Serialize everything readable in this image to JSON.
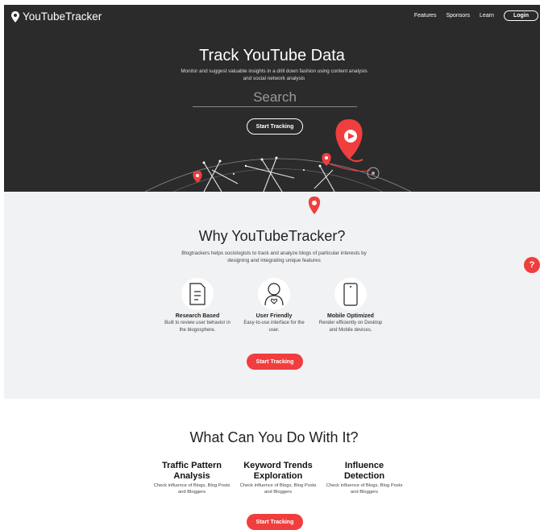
{
  "header": {
    "brand": "YouTubeTracker",
    "nav": [
      "Features",
      "Sponsors",
      "Learn"
    ],
    "login_label": "Login"
  },
  "hero": {
    "title": "Track YouTube Data",
    "subtitle": "Monitor and suggest valuable insights in a drill down fashion using content analysis and social network analysis",
    "search_placeholder": "Search",
    "cta_label": "Start Tracking"
  },
  "why": {
    "title": "Why YouTubeTracker?",
    "subtitle": "Blogtrackers helps sociologists to track and analyze blogs of particular interests by designing and integrating unique features",
    "features": [
      {
        "title": "Research Based",
        "desc": "Built to review user behavior in the blogosphere.",
        "icon": "document-icon"
      },
      {
        "title": "User Friendly",
        "desc": "Easy-to-use interface for the user.",
        "icon": "user-heart-icon"
      },
      {
        "title": "Mobile Optimized",
        "desc": "Render efficiently on Desktop and Mobile devices.",
        "icon": "phone-icon"
      }
    ],
    "cta_label": "Start Tracking"
  },
  "help": {
    "label": "?"
  },
  "what": {
    "title": "What Can You Do With It?",
    "items": [
      {
        "title": "Traffic Pattern Analysis",
        "desc": "Check influence of Blogs, Blog Posts and Bloggers"
      },
      {
        "title": "Keyword Trends Exploration",
        "desc": "Check influence of Blogs, Blog Posts and Bloggers"
      },
      {
        "title": "Influence Detection",
        "desc": "Check influence of Blogs, Blog Posts and Bloggers"
      }
    ],
    "cta_label": "Start Tracking"
  },
  "colors": {
    "accent": "#f03e3e",
    "hero_bg": "#2b2b2b",
    "section_bg": "#f1f2f4"
  }
}
